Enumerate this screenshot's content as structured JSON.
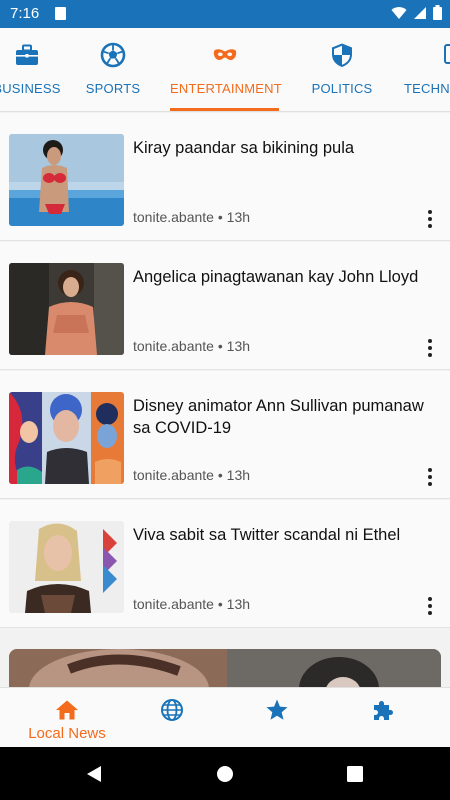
{
  "status_bar": {
    "time": "7:16",
    "icons": [
      "sd-card-icon",
      "wifi-icon",
      "signal-icon",
      "battery-icon"
    ]
  },
  "tabs": [
    {
      "label": "BUSINESS",
      "icon": "briefcase-icon",
      "active": false
    },
    {
      "label": "SPORTS",
      "icon": "soccer-ball-icon",
      "active": false
    },
    {
      "label": "ENTERTAINMENT",
      "icon": "mask-icon",
      "active": true
    },
    {
      "label": "POLITICS",
      "icon": "shield-icon",
      "active": false
    },
    {
      "label": "TECHNOLOGY",
      "icon": "device-icon",
      "active": false
    }
  ],
  "articles": [
    {
      "title": "Kiray paandar sa bikining pula",
      "source": "tonite.abante",
      "age": "13h"
    },
    {
      "title": "Angelica pinagtawanan kay John Lloyd",
      "source": "tonite.abante",
      "age": "13h"
    },
    {
      "title": "Disney animator Ann Sullivan pumanaw sa COVID-19",
      "source": "tonite.abante",
      "age": "13h"
    },
    {
      "title": "Viva sabit sa Twitter scandal ni Ethel",
      "source": "tonite.abante",
      "age": "13h"
    }
  ],
  "meta_separator": "•",
  "bottom_nav": [
    {
      "label": "Local News",
      "icon": "home-icon",
      "active": true
    },
    {
      "label": "",
      "icon": "globe-icon",
      "active": false
    },
    {
      "label": "",
      "icon": "star-icon",
      "active": false
    },
    {
      "label": "",
      "icon": "puzzle-icon",
      "active": false
    }
  ],
  "system_nav": [
    "back-icon",
    "home-circle-icon",
    "recents-icon"
  ],
  "colors": {
    "accent": "#f36b1c",
    "primary": "#1a73b8",
    "status_bar": "#1a73b8"
  }
}
